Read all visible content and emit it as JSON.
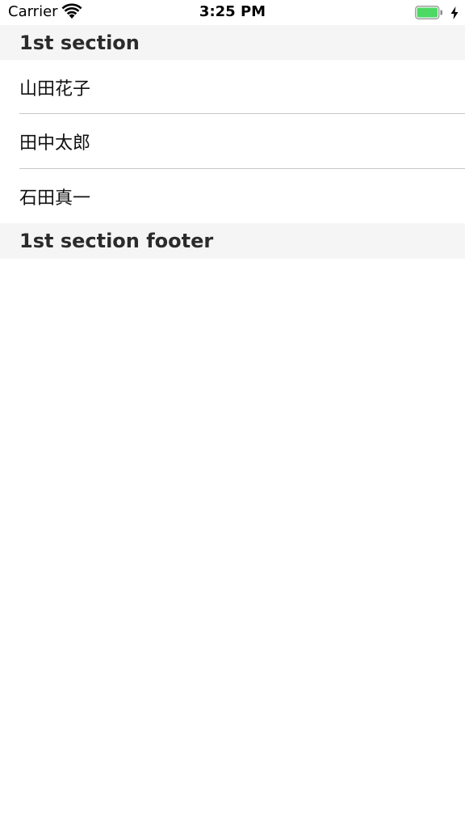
{
  "status_bar": {
    "carrier": "Carrier",
    "time": "3:25 PM",
    "battery_color": "#4cd964"
  },
  "table": {
    "section_header": "1st section",
    "rows": [
      {
        "label": "山田花子"
      },
      {
        "label": "田中太郎"
      },
      {
        "label": "石田真一"
      }
    ],
    "section_footer": "1st section footer"
  }
}
